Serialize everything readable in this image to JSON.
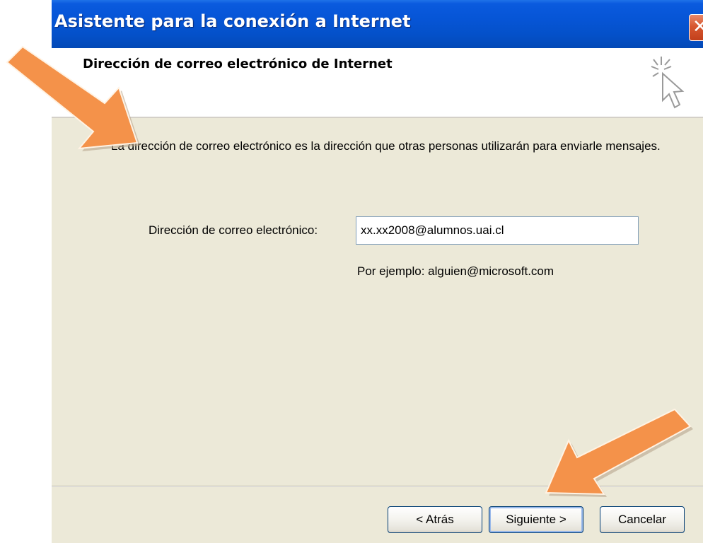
{
  "window": {
    "title": "Asistente para la conexión a Internet",
    "close_label": "✕"
  },
  "header": {
    "title": "Dirección de correo electrónico de Internet",
    "icon": "wizard-cursor-icon"
  },
  "body": {
    "description": "La dirección de correo electrónico es la dirección que otras personas utilizarán para enviarle mensajes.",
    "email_label": "Dirección de correo electrónico:",
    "email_value": "xx.xx2008@alumnos.uai.cl",
    "example": "Por ejemplo: alguien@microsoft.com"
  },
  "buttons": {
    "back": "< Atrás",
    "next": "Siguiente >",
    "cancel": "Cancelar"
  },
  "annotations": {
    "arrow_color": "#f4924a",
    "arrow_icons": [
      "annotation-arrow-icon",
      "annotation-arrow-icon"
    ]
  },
  "colors": {
    "titlebar": "#0655d6",
    "dialog_bg": "#ece9d8",
    "close": "#d7572f"
  }
}
